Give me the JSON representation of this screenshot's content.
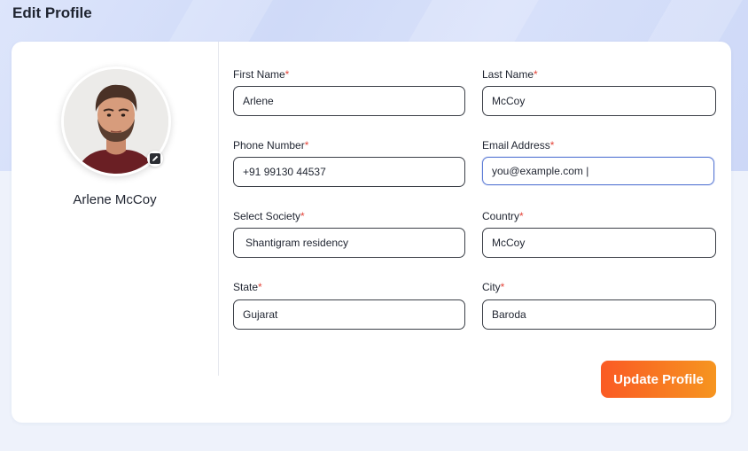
{
  "page": {
    "title": "Edit Profile"
  },
  "profile": {
    "name": "Arlene McCoy",
    "avatar_icon": "user-photo",
    "edit_icon": "pencil-icon"
  },
  "form": {
    "required_mark": "*",
    "first_name": {
      "label": "First Name",
      "value": "Arlene"
    },
    "last_name": {
      "label": "Last Name",
      "value": "McCoy"
    },
    "phone": {
      "label": "Phone Number",
      "value": "+91 99130 44537"
    },
    "email": {
      "label": "Email Address",
      "value": "you@example.com |"
    },
    "society": {
      "label": "Select Society",
      "value": "Shantigram residency"
    },
    "country": {
      "label": "Country",
      "value": "McCoy"
    },
    "state": {
      "label": "State",
      "value": "Gujarat"
    },
    "city": {
      "label": "City",
      "value": "Baroda"
    }
  },
  "actions": {
    "update_label": "Update Profile"
  },
  "colors": {
    "accent_start": "#fa5a24",
    "accent_end": "#f69520",
    "required": "#e4453a",
    "focus_border": "#5b7bd5"
  }
}
